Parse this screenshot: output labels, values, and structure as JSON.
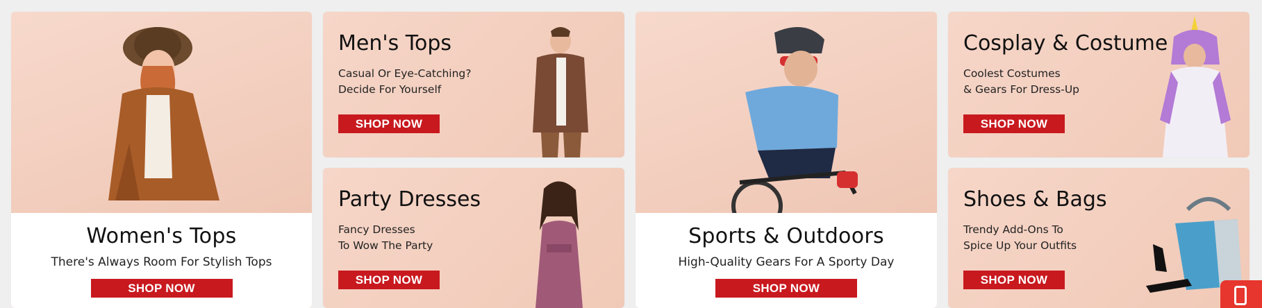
{
  "cards": [
    {
      "title": "Women's Tops",
      "subtitle": "There's Always Room For Stylish Tops",
      "button": "SHOP NOW"
    },
    {
      "title": "Men's Tops",
      "subtitle_line1": "Casual Or Eye-Catching?",
      "subtitle_line2": "Decide For Yourself",
      "button": "SHOP NOW"
    },
    {
      "title": "Party Dresses",
      "subtitle_line1": "Fancy Dresses",
      "subtitle_line2": "To Wow The Party",
      "button": "SHOP NOW"
    },
    {
      "title": "Sports & Outdoors",
      "subtitle": "High-Quality Gears For A Sporty Day",
      "button": "SHOP NOW"
    },
    {
      "title": "Cosplay & Costume",
      "subtitle_line1": "Coolest Costumes",
      "subtitle_line2": "& Gears For Dress-Up",
      "button": "SHOP NOW"
    },
    {
      "title": "Shoes & Bags",
      "subtitle_line1": "Trendy Add-Ons To",
      "subtitle_line2": "Spice Up Your Outfits",
      "button": "SHOP NOW"
    }
  ],
  "colors": {
    "accent": "#c8191f",
    "card_bg": "#f3cfbf",
    "page_bg": "#efefef"
  },
  "icons": {
    "floating": "phone-icon"
  }
}
